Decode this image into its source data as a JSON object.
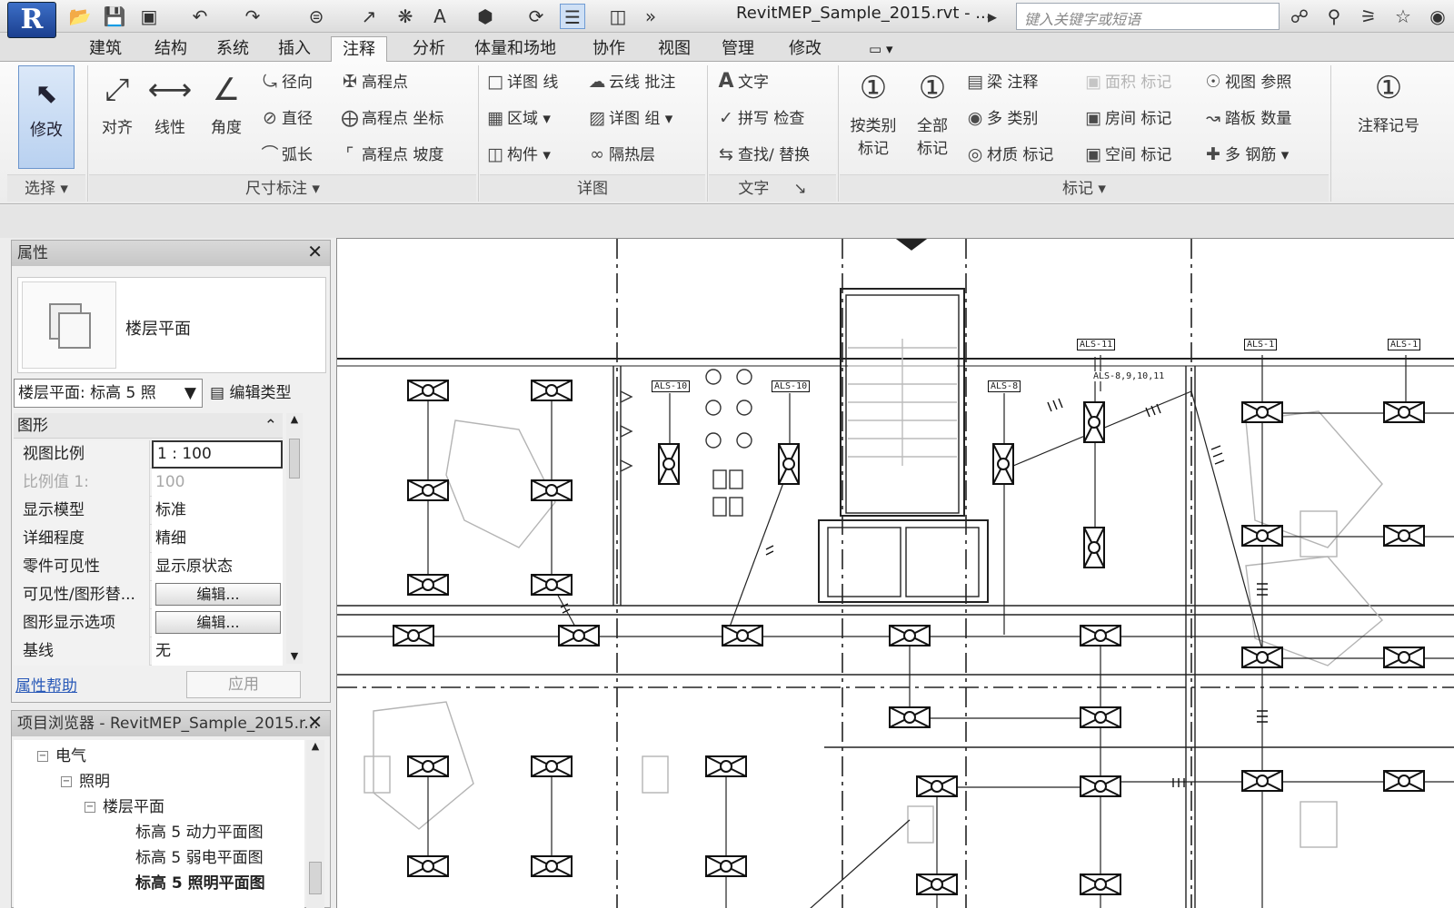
{
  "app": {
    "title": "RevitMEP_Sample_2015.rvt - ...",
    "search_placeholder": "键入关键字或短语"
  },
  "qat": {
    "icons": [
      "open-icon",
      "save-icon",
      "sync-icon",
      "undo-icon",
      "redo-icon",
      "measure-icon",
      "dimension-icon",
      "tag-icon",
      "text-A-icon",
      "3d-view-icon",
      "section-icon",
      "thin-lines-icon",
      "close-hidden-icon",
      "more-icon"
    ]
  },
  "tabs": [
    "建筑",
    "结构",
    "系统",
    "插入",
    "注释",
    "分析",
    "体量和场地",
    "协作",
    "视图",
    "管理",
    "修改"
  ],
  "active_tab": "注释",
  "ribbon": {
    "select": {
      "modify": "修改",
      "label": "选择"
    },
    "dimension": {
      "label": "尺寸标注",
      "aligned": "对齐",
      "linear": "线性",
      "angular": "角度",
      "radial": "径向",
      "diameter": "直径",
      "arc_length": "弧长",
      "spot_elev": "高程点",
      "spot_coord": "高程点 坐标",
      "spot_slope": "高程点 坡度"
    },
    "detail": {
      "label": "详图",
      "detail_line": "详图 线",
      "region": "区域",
      "component": "构件",
      "revision_cloud": "云线 批注",
      "detail_group": "详图 组",
      "insulation": "隔热层"
    },
    "text": {
      "label": "文字",
      "text": "文字",
      "spelling": "拼写 检查",
      "find_replace": "查找/ 替换"
    },
    "tag": {
      "label": "标记",
      "by_category": "按类别 标记",
      "all": "全部 标记",
      "beam_annot": "梁 注释",
      "multi_cat": "多 类别",
      "material": "材质 标记",
      "area": "面积 标记",
      "room": "房间 标记",
      "space": "空间 标记",
      "view_ref": "视图 参照",
      "tread": "踏板 数量",
      "multi_rebar": "多 钢筋",
      "keynote": "注释记号"
    }
  },
  "properties": {
    "title": "属性",
    "type_name": "楼层平面",
    "type_selector": "楼层平面: 标高 5 照",
    "edit_type": "编辑类型",
    "group": "图形",
    "rows": [
      {
        "key": "视图比例",
        "value": "1 : 100",
        "kind": "input"
      },
      {
        "key": "比例值 1:",
        "value": "100",
        "kind": "disabled"
      },
      {
        "key": "显示模型",
        "value": "标准",
        "kind": "text"
      },
      {
        "key": "详细程度",
        "value": "精细",
        "kind": "text"
      },
      {
        "key": "零件可见性",
        "value": "显示原状态",
        "kind": "text"
      },
      {
        "key": "可见性/图形替...",
        "value": "编辑...",
        "kind": "button"
      },
      {
        "key": "图形显示选项",
        "value": "编辑...",
        "kind": "button"
      },
      {
        "key": "基线",
        "value": "无",
        "kind": "text"
      }
    ],
    "help": "属性帮助",
    "apply": "应用"
  },
  "browser": {
    "title": "项目浏览器 - RevitMEP_Sample_2015.r...",
    "items": [
      {
        "label": "电气",
        "level": 0,
        "exp": "-"
      },
      {
        "label": "照明",
        "level": 1,
        "exp": "-"
      },
      {
        "label": "楼层平面",
        "level": 2,
        "exp": "-"
      },
      {
        "label": "标高 5 动力平面图",
        "level": 3,
        "exp": ""
      },
      {
        "label": "标高 5 弱电平面图",
        "level": 3,
        "exp": ""
      },
      {
        "label": "标高 5 照明平面图",
        "level": 3,
        "exp": "",
        "bold": true
      }
    ]
  },
  "drawing": {
    "tags": [
      "ALS-10",
      "ALS-10",
      "ALS-8",
      "ALS-11",
      "ALS-8,9,10,11",
      "ALS-1",
      "ALS-1"
    ]
  }
}
